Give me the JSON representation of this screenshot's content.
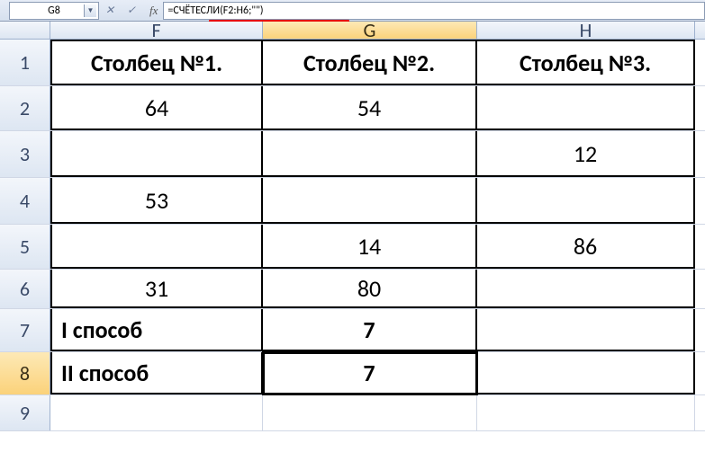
{
  "formula_bar": {
    "cell_ref": "G8",
    "fx_label": "fx",
    "formula": "=СЧЁТЕСЛИ(F2:H6;\"\")"
  },
  "columns": {
    "f": "F",
    "g": "G",
    "h": "H"
  },
  "rows": {
    "r1": "1",
    "r2": "2",
    "r3": "3",
    "r4": "4",
    "r5": "5",
    "r6": "6",
    "r7": "7",
    "r8": "8",
    "r9": "9"
  },
  "data": {
    "header": {
      "f": "Столбец №1.",
      "g": "Столбец №2.",
      "h": "Столбец №3."
    },
    "r2": {
      "f": "64",
      "g": "54",
      "h": ""
    },
    "r3": {
      "f": "",
      "g": "",
      "h": "12"
    },
    "r4": {
      "f": "53",
      "g": "",
      "h": ""
    },
    "r5": {
      "f": "",
      "g": "14",
      "h": "86"
    },
    "r6": {
      "f": "31",
      "g": "80",
      "h": ""
    },
    "r7": {
      "f": "I способ",
      "g": "7",
      "h": ""
    },
    "r8": {
      "f": "II способ",
      "g": "7",
      "h": ""
    }
  },
  "chart_data": {
    "type": "table",
    "title": "",
    "columns": [
      "Столбец №1.",
      "Столбец №2.",
      "Столбец №3."
    ],
    "rows": [
      [
        64,
        54,
        null
      ],
      [
        null,
        null,
        12
      ],
      [
        53,
        null,
        null
      ],
      [
        null,
        14,
        86
      ],
      [
        31,
        80,
        null
      ]
    ],
    "summary": [
      {
        "label": "I способ",
        "value": 7
      },
      {
        "label": "II способ",
        "value": 7,
        "formula": "=СЧЁТЕСЛИ(F2:H6;\"\")"
      }
    ]
  }
}
